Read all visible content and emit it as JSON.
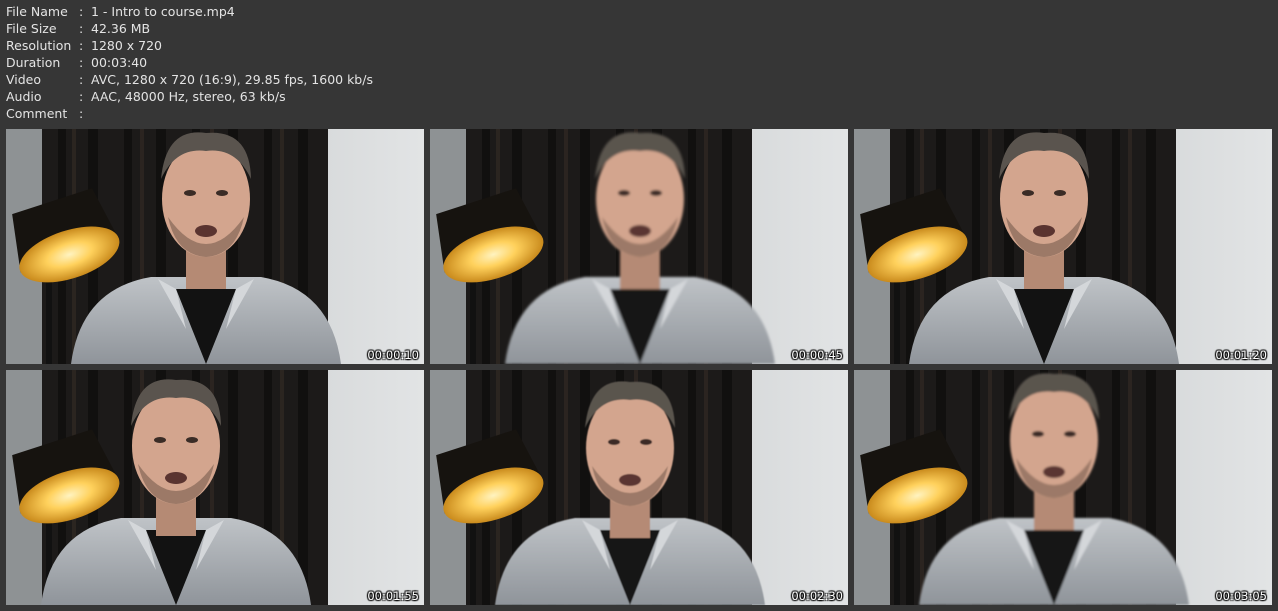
{
  "info": [
    {
      "label": "File Name",
      "colon": ":",
      "value": "1 - Intro to course.mp4"
    },
    {
      "label": "File Size",
      "colon": ":",
      "value": "42.36 MB"
    },
    {
      "label": "Resolution",
      "colon": ":",
      "value": "1280 x 720"
    },
    {
      "label": "Duration",
      "colon": ":",
      "value": "00:03:40"
    },
    {
      "label": "Video",
      "colon": ":",
      "value": "AVC, 1280 x 720 (16:9), 29.85 fps, 1600 kb/s"
    },
    {
      "label": "Audio",
      "colon": ":",
      "value": "AAC, 48000 Hz, stereo, 63 kb/s"
    },
    {
      "label": "Comment",
      "colon": ":",
      "value": ""
    }
  ],
  "thumbnails": [
    {
      "timestamp": "00:00:10"
    },
    {
      "timestamp": "00:00:45"
    },
    {
      "timestamp": "00:01:20"
    },
    {
      "timestamp": "00:01:55"
    },
    {
      "timestamp": "00:02:30"
    },
    {
      "timestamp": "00:03:05"
    }
  ],
  "colors": {
    "background": "#363636",
    "text": "#e4e4e4",
    "lamp_glow": "#ffd15c",
    "curtain": "#1c1a19",
    "wall": "#c9cdd0"
  }
}
